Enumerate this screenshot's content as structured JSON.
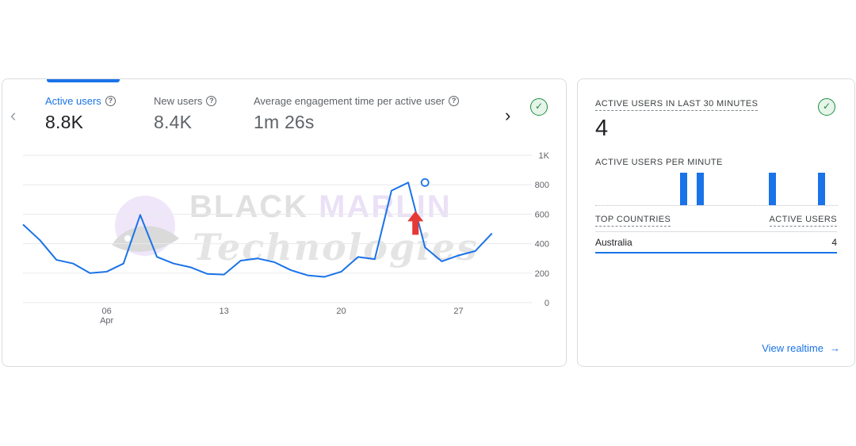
{
  "metrics": [
    {
      "label": "Active users",
      "value": "8.8K"
    },
    {
      "label": "New users",
      "value": "8.4K"
    },
    {
      "label": "Average engagement time per active user",
      "value": "1m 26s"
    }
  ],
  "icons": {
    "prev": "chevron-left-icon",
    "next": "chevron-right-icon",
    "help": "help-circle-icon",
    "check": "check-circle-icon",
    "arrow": "arrow-right-icon",
    "annotation": "red-up-arrow-icon"
  },
  "colors": {
    "accent": "#1a73e8",
    "success": "#1e8e3e",
    "annotation": "#e53935"
  },
  "watermark": {
    "word1": "BLACK",
    "word2": "MARLIN",
    "line2": "Technologies"
  },
  "chart_data": {
    "type": "line",
    "y_ticks": [
      "1K",
      "800",
      "600",
      "400",
      "200",
      "0"
    ],
    "ylim": [
      0,
      1000
    ],
    "x_ticks": [
      {
        "day": 6,
        "label": "06",
        "sublabel": "Apr"
      },
      {
        "day": 13,
        "label": "13"
      },
      {
        "day": 20,
        "label": "20"
      },
      {
        "day": 27,
        "label": "27"
      }
    ],
    "x": [
      1,
      2,
      3,
      4,
      5,
      6,
      7,
      8,
      9,
      10,
      11,
      12,
      13,
      14,
      15,
      16,
      17,
      18,
      19,
      20,
      21,
      22,
      23,
      24,
      25,
      26,
      27,
      28,
      29,
      30,
      31
    ],
    "series": [
      {
        "values": [
          530,
          425,
          290,
          265,
          200,
          210,
          265,
          595,
          310,
          265,
          240,
          195,
          190,
          285,
          300,
          275,
          220,
          185,
          175,
          210,
          310,
          295,
          760,
          815,
          375,
          280,
          320,
          350,
          470
        ]
      }
    ],
    "highlight_point": {
      "x": 25,
      "y": 815
    },
    "grid": true
  },
  "realtime": {
    "title": "ACTIVE USERS IN LAST 30 MINUTES",
    "count": "4",
    "per_minute_label": "ACTIVE USERS PER MINUTE",
    "per_minute_bars": [
      {
        "minute": 11,
        "value": 1
      },
      {
        "minute": 13,
        "value": 1
      },
      {
        "minute": 22,
        "value": 1
      },
      {
        "minute": 28,
        "value": 1
      }
    ],
    "table_headers": [
      "TOP COUNTRIES",
      "ACTIVE USERS"
    ],
    "rows": [
      {
        "country": "Australia",
        "users": "4",
        "share": 1.0
      }
    ],
    "link": "View realtime"
  }
}
